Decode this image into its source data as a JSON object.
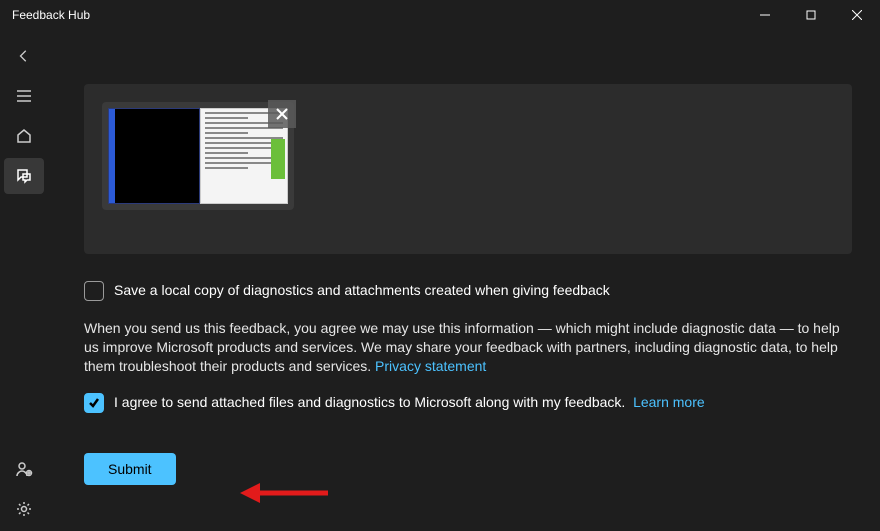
{
  "window": {
    "title": "Feedback Hub"
  },
  "checkbox_save_local": {
    "label": "Save a local copy of diagnostics and attachments created when giving feedback",
    "checked": false
  },
  "disclaimer": {
    "text_before_link": "When you send us this feedback, you agree we may use this information — which might include diagnostic data — to help us improve Microsoft products and services. We may share your feedback with partners, including diagnostic data, to help them troubleshoot their products and services. ",
    "privacy_link": "Privacy statement"
  },
  "checkbox_agree": {
    "label": "I agree to send attached files and diagnostics to Microsoft along with my feedback.",
    "learn_more": "Learn more",
    "checked": true
  },
  "submit": {
    "label": "Submit"
  }
}
